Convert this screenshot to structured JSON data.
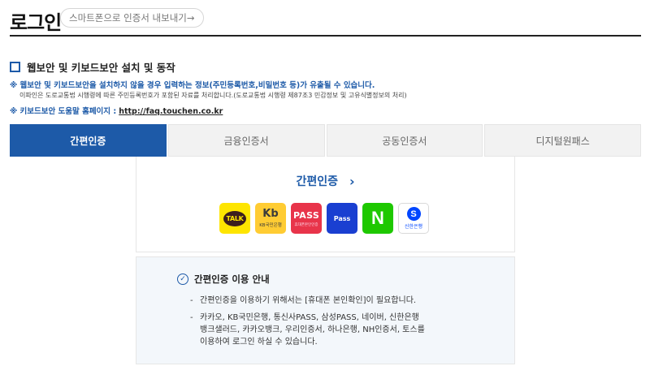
{
  "header": {
    "title": "로그인",
    "export_link": "스마트폰으로 인증서 내보내기→"
  },
  "security_option": {
    "checked": false,
    "label": "웹보안 및 키보드보안 설치 및 동작"
  },
  "notices": {
    "warning": "※ 웹보안 및 키보드보안을 설치하지 않을 경우 입력하는 정보(주민등록번호,비밀번호 등)가 유출될 수 있습니다.",
    "warning_sub": "이파인은 도로교통법 시행령에 따른 주민등록번호가 포함된 자료를 처리합니다.(도로교통법 시행령 제87조3 민감정보 및 고유식별정보의 처리)",
    "help_prefix": "※ 키보드보안 도움말 홈페이지 :",
    "help_url": "http://faq.touchen.co.kr"
  },
  "tabs": [
    {
      "label": "간편인증",
      "active": true
    },
    {
      "label": "금융인증서",
      "active": false
    },
    {
      "label": "공동인증서",
      "active": false
    },
    {
      "label": "디지털원패스",
      "active": false
    }
  ],
  "simple_auth": {
    "heading": "간편인증",
    "providers": [
      {
        "name": "kakao",
        "icon": "kakao-icon",
        "text": "TALK"
      },
      {
        "name": "kb",
        "icon": "kb-icon",
        "text": "Kb",
        "sub": "KB국민은행"
      },
      {
        "name": "pass",
        "icon": "pass-icon",
        "text": "PASS",
        "sub": "휴대폰본인인증"
      },
      {
        "name": "samsung-pass",
        "icon": "samsung-pass-icon",
        "text": "Pass"
      },
      {
        "name": "naver",
        "icon": "naver-icon",
        "text": "N"
      },
      {
        "name": "shinhan",
        "icon": "shinhan-icon",
        "text": "S",
        "sub": "신한은행"
      }
    ]
  },
  "guide": {
    "title": "간편인증 이용 안내",
    "item1": "간편인증을 이용하기 위해서는 [휴대폰 본인확인]이 필요합니다.",
    "item2_line1": "카카오, KB국민은행, 통신사PASS, 삼성PASS, 네이버, 신한은행",
    "item2_line2": "뱅크샐러드, 카카오뱅크, 우리인증서, 하나은행, NH인증서, 토스를",
    "item2_line3": "이용하여 로그인 하실 수 있습니다."
  },
  "colors": {
    "primary": "#1d5aa8",
    "kakao": "#fee500",
    "kb": "#ffcc33",
    "pass": "#e8344a",
    "samsung_pass": "#1a3fd1",
    "naver": "#1ec800",
    "shinhan": "#0046ff"
  }
}
